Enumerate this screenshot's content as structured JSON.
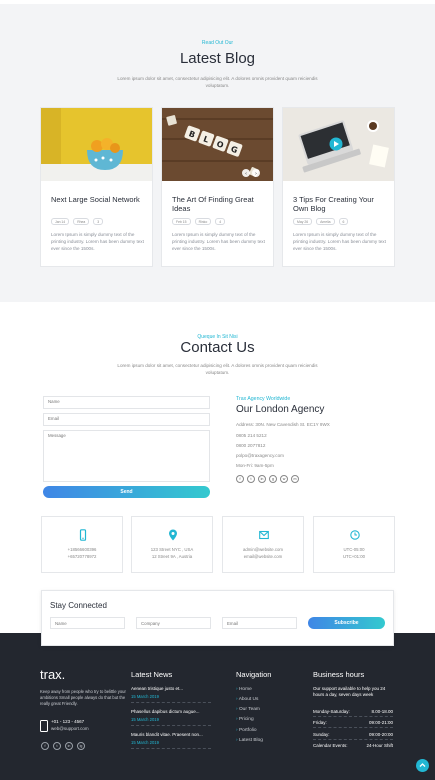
{
  "blog": {
    "eyebrow": "Read Out Our",
    "title": "Latest Blog",
    "subtitle": "Lorem ipsum dolor sit amet, consectetur adipisicing elit. A dolores omnis provident quam reiciendis voluptatum.",
    "posts": [
      {
        "title": "Next Large Social Network",
        "date": "Jan 14",
        "author": "Rhea",
        "comments": "3",
        "excerpt": "Lorem Ipsum is simply dummy text of the printing industry. Lorem has been dummy text ever since the 1500s."
      },
      {
        "title": "The Art Of Finding Great Ideas",
        "date": "Feb 15",
        "author": "Rinko",
        "comments": "4",
        "excerpt": "Lorem Ipsum is simply dummy text of the printing industry. Lorem has been dummy text ever since the 1500s."
      },
      {
        "title": "3 Tips For Creating Your Own Blog",
        "date": "May 26",
        "author": "Amelia",
        "comments": "6",
        "excerpt": "Lorem Ipsum is simply dummy text of the printing industry. Lorem has been dummy text ever since the 1500s."
      }
    ]
  },
  "contact": {
    "eyebrow": "Queque In Sit Nisi",
    "title": "Contact Us",
    "subtitle": "Lorem ipsum dolor sit amet, consectetur adipisicing elit. A dolores omnis provident quam reiciendis voluptatum.",
    "form": {
      "name_placeholder": "Name",
      "email_placeholder": "Email",
      "message_placeholder": "Message",
      "send_label": "Send"
    },
    "agency": {
      "eyebrow": "Trax Agency Worldwide",
      "title": "Our London Agency",
      "address": "Address: 30N. New Cavendish St. EC1Y 9WX",
      "phone1": "0805 214 5212",
      "phone2": "0800 2077812",
      "email": "polpo@traxagency.com",
      "hours": "Mon-Fri: 9am-5pm",
      "social": [
        "f",
        "t",
        "in",
        "g",
        "w",
        "m"
      ]
    },
    "info_boxes": [
      {
        "icon": "phone-icon",
        "line1": "+18566600396",
        "line2": "+65720778972"
      },
      {
        "icon": "location-pin-icon",
        "line1": "123 Street NYC , USA",
        "line2": "12 Street 9A , Austria"
      },
      {
        "icon": "envelope-icon",
        "line1": "admin@website.com",
        "line2": "email@website.com"
      },
      {
        "icon": "clock-icon",
        "line1": "UTC-05:00",
        "line2": "UTC+01:00"
      }
    ]
  },
  "newsletter": {
    "title": "Stay Connected",
    "name_placeholder": "Name",
    "company_placeholder": "Company",
    "email_placeholder": "Email",
    "subscribe_label": "Subscribe"
  },
  "footer": {
    "logo": "trax.",
    "about": "Keep away from people who try to belittle your ambitions Small people always do that but the really great Friendly.",
    "phone": "+01 - 123 - 4567",
    "email": "web@support.com",
    "social": [
      "f",
      "t",
      "in",
      "ig"
    ],
    "news_title": "Latest News",
    "news": [
      {
        "title": "Aenean tristique justo et...",
        "date": "15 March 2019"
      },
      {
        "title": "Phasellus dapibus dictum augue...",
        "date": "15 March 2019"
      },
      {
        "title": "Mauris blandit vitae. Praesent non...",
        "date": "15 March 2019"
      }
    ],
    "nav_title": "Navigation",
    "nav": [
      "Home",
      "About Us",
      "Our Team",
      "Pricing",
      "Portfolio",
      "Latest Blog"
    ],
    "hours_title": "Business hours",
    "hours_intro": "Our support available to help you 24 hours a day, seven days week",
    "hours": [
      {
        "day": "Monday-Saturday:",
        "time": "8.00-18.00"
      },
      {
        "day": "Friday:",
        "time": "09:00-21:00"
      },
      {
        "day": "Sunday:",
        "time": "09:00-20:00"
      },
      {
        "day": "Calendar Events:",
        "time": "24-Hour Shift"
      }
    ]
  },
  "colors": {
    "accent": "#22b7d3",
    "gradient_start": "#3f86e6",
    "gradient_end": "#33c9cf",
    "footer_bg": "#23272f"
  }
}
